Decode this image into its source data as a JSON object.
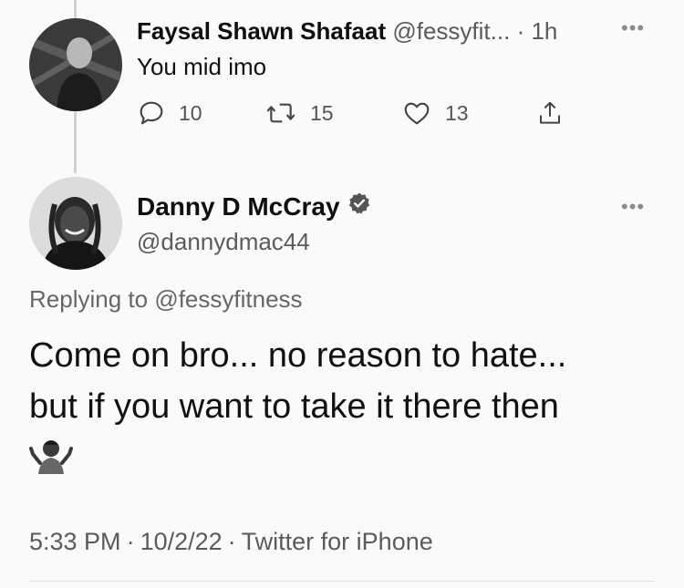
{
  "reply": {
    "name": "Faysal Shawn Shafaat",
    "handle": "@fessyfit...",
    "time": "· 1h",
    "text": "You mid imo",
    "actions": {
      "replies": "10",
      "retweets": "15",
      "likes": "13"
    },
    "avatar_icon": "profile-photo"
  },
  "tweet": {
    "author_name": "Danny D McCray",
    "author_handle": "@dannydmac44",
    "verified": true,
    "replying_to_label": "Replying to ",
    "replying_to_handle": "@fessyfitness",
    "body_line1": "Come on bro... no reason to hate...",
    "body_line2": "but if you want to take it there then",
    "emoji": "person-shrugging-emoji",
    "time": "5:33 PM",
    "date": "10/2/22",
    "source": "Twitter for iPhone"
  },
  "icons": {
    "more": "more-horizontal-icon",
    "reply": "reply-bubble-icon",
    "retweet": "retweet-icon",
    "like": "heart-icon",
    "share": "share-upload-icon"
  }
}
